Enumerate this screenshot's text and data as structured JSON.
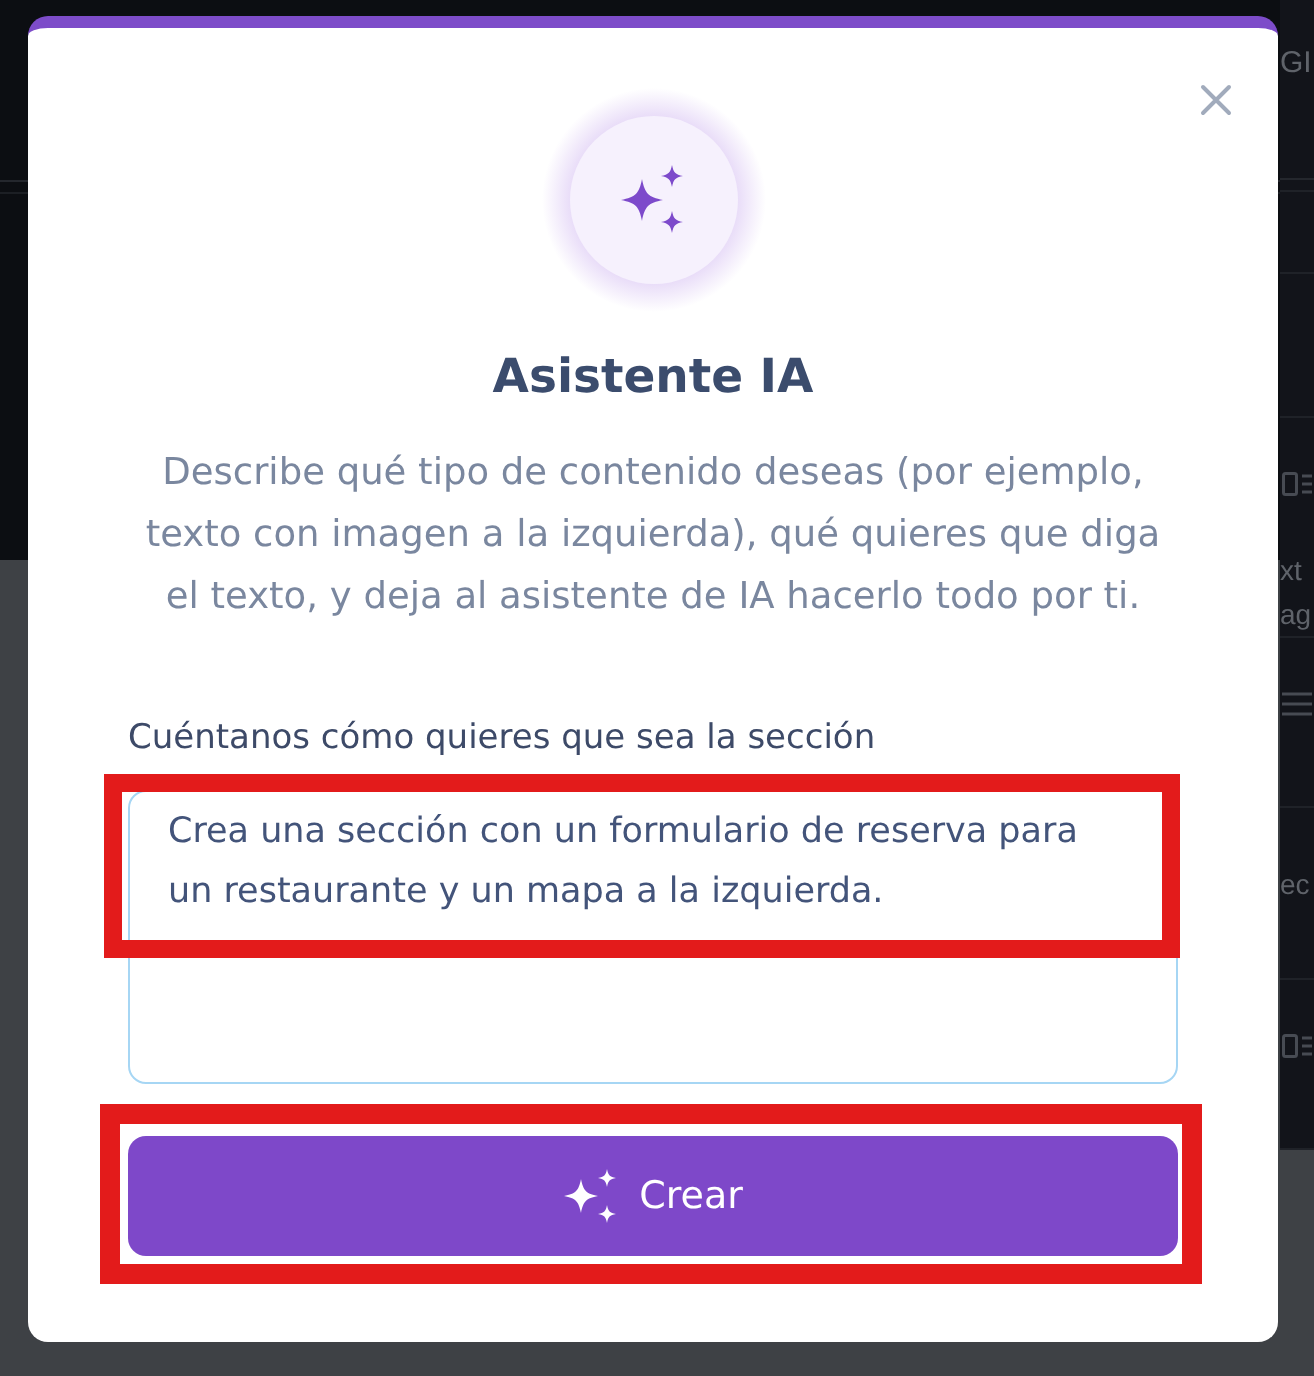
{
  "background_panel": {
    "title": "GI",
    "sections": [
      {
        "kind": "card",
        "lines": [
          "xt",
          "ag"
        ]
      },
      {
        "kind": "list"
      },
      {
        "kind": "text",
        "lines": [
          "ec"
        ]
      },
      {
        "kind": "card"
      }
    ]
  },
  "dialog": {
    "title": "Asistente IA",
    "description": "Describe qué tipo de contenido deseas (por ejemplo, texto con imagen a la izquierda), qué quieres que diga el texto, y deja al asistente de IA hacerlo todo por ti.",
    "prompt_field": {
      "label": "Cuéntanos cómo quieres que sea la sección",
      "value": "Crea una sección con un formulario de reserva para un restaurante y un mapa a la izquierda.",
      "highlighted": true
    },
    "create_button": {
      "label": "Crear",
      "highlighted": true
    }
  }
}
